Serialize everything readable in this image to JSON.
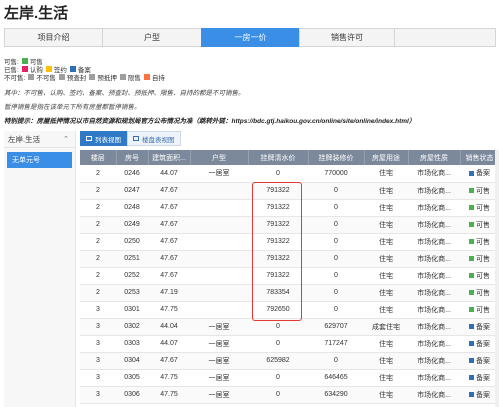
{
  "page_title": "左岸.生活",
  "tabs": [
    {
      "label": "项目介绍",
      "active": false
    },
    {
      "label": "户型",
      "active": false
    },
    {
      "label": "一房一价",
      "active": true
    },
    {
      "label": "销售许可",
      "active": false
    }
  ],
  "legend": {
    "sellable_label": "可售:",
    "sold_label": "已售:",
    "unsellable_label": "不可售:",
    "items": {
      "ke_shou": {
        "label": "可售",
        "color": "#4caf50"
      },
      "ren_gou": {
        "label": "认购",
        "color": "#e91e63"
      },
      "qian_yue": {
        "label": "签约",
        "color": "#ffc107"
      },
      "bei_an": {
        "label": "备案",
        "color": "#2f6fb8"
      },
      "bu_ke_shou": {
        "label": "不可售",
        "color": "#9e9e9e"
      },
      "yu_cha_feng": {
        "label": "预查封",
        "color": "#9e9e9e"
      },
      "yu_di_ya": {
        "label": "预抵押",
        "color": "#9e9e9e"
      },
      "yu_shou": {
        "label": "限售",
        "color": "#9e9e9e"
      },
      "zi_chi": {
        "label": "自持",
        "color": "#ff7043"
      }
    }
  },
  "notes": {
    "line1": "其中：不可售、认购、签约、备案、预查封、预抵押、限售、自持的都是不可销售。",
    "line2": "暂停销售是指在该单元下所有房屋都暂停销售。",
    "line3": "特别提示：房屋抵押情况以市自然资源和规划局官方公布情况为准（跳转外链：https://bdc.gtj.haikou.gov.cn/online/site/online/index.html）"
  },
  "sidebar": {
    "header": "左岸.生活",
    "items": [
      "无单元号"
    ]
  },
  "view_buttons": {
    "list": "列表视图",
    "grid": "楼盘表视图"
  },
  "table": {
    "headers": [
      "楼层",
      "房号",
      "建筑面积...",
      "户型",
      "挂牌清水价",
      "挂牌装修价",
      "房屋用途",
      "房屋性质",
      "销售状态"
    ],
    "rows": [
      [
        "2",
        "0246",
        "44.07",
        "一居室",
        "0",
        "770000",
        "住宅",
        "市场化商...",
        "备案"
      ],
      [
        "2",
        "0247",
        "47.67",
        "",
        "791322",
        "0",
        "住宅",
        "市场化商...",
        "可售"
      ],
      [
        "2",
        "0248",
        "47.67",
        "",
        "791322",
        "0",
        "住宅",
        "市场化商...",
        "可售"
      ],
      [
        "2",
        "0249",
        "47.67",
        "",
        "791322",
        "0",
        "住宅",
        "市场化商...",
        "可售"
      ],
      [
        "2",
        "0250",
        "47.67",
        "",
        "791322",
        "0",
        "住宅",
        "市场化商...",
        "可售"
      ],
      [
        "2",
        "0251",
        "47.67",
        "",
        "791322",
        "0",
        "住宅",
        "市场化商...",
        "可售"
      ],
      [
        "2",
        "0252",
        "47.67",
        "",
        "791322",
        "0",
        "住宅",
        "市场化商...",
        "可售"
      ],
      [
        "2",
        "0253",
        "47.19",
        "",
        "783354",
        "0",
        "住宅",
        "市场化商...",
        "可售"
      ],
      [
        "3",
        "0301",
        "47.75",
        "",
        "792650",
        "0",
        "住宅",
        "市场化商...",
        "可售"
      ],
      [
        "3",
        "0302",
        "44.04",
        "一居室",
        "0",
        "629707",
        "成套住宅",
        "市场化商...",
        "备案"
      ],
      [
        "3",
        "0303",
        "44.07",
        "一居室",
        "0",
        "717247",
        "住宅",
        "市场化商...",
        "备案"
      ],
      [
        "3",
        "0304",
        "47.67",
        "一居室",
        "625982",
        "0",
        "住宅",
        "市场化商...",
        "备案"
      ],
      [
        "3",
        "0305",
        "47.75",
        "一居室",
        "0",
        "646465",
        "住宅",
        "市场化商...",
        "备案"
      ],
      [
        "3",
        "0306",
        "47.75",
        "一居室",
        "0",
        "634290",
        "住宅",
        "市场化商...",
        "备案"
      ]
    ],
    "status_colors": {
      "备案": "#2f6fb8",
      "可售": "#4caf50"
    }
  }
}
